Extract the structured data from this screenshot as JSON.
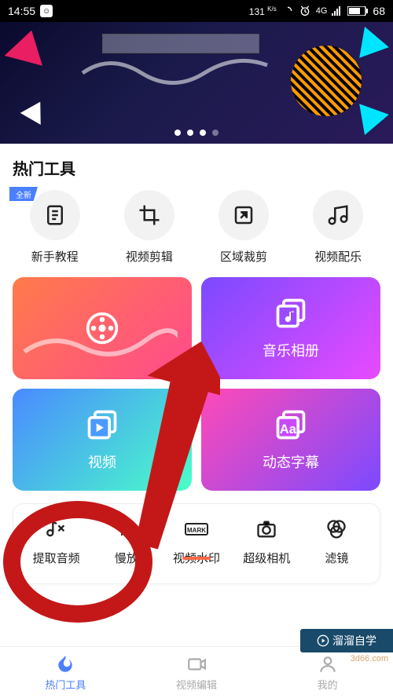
{
  "status": {
    "time": "14:55",
    "net_speed": "131",
    "net_unit": "K/s",
    "signal": "4G",
    "battery": "68"
  },
  "banner": {
    "dots": 4,
    "active_dot": 3
  },
  "section_title": "热门工具",
  "tools": [
    {
      "label": "新手教程",
      "icon": "doc-icon",
      "badge": "全新"
    },
    {
      "label": "视频剪辑",
      "icon": "crop-icon",
      "badge": null
    },
    {
      "label": "区域裁剪",
      "icon": "expand-icon",
      "badge": null
    },
    {
      "label": "视频配乐",
      "icon": "music-icon",
      "badge": null
    }
  ],
  "cards": [
    {
      "label": "",
      "icon": "film-icon",
      "cls": "c1"
    },
    {
      "label": "音乐相册",
      "icon": "music-stack-icon",
      "cls": "c2"
    },
    {
      "label": "视频",
      "icon": "play-stack-icon",
      "cls": "c3"
    },
    {
      "label": "动态字幕",
      "icon": "aa-stack-icon",
      "cls": "c4"
    }
  ],
  "row_tools": [
    {
      "label": "提取音频",
      "icon": "extract-audio-icon",
      "active": false
    },
    {
      "label": "慢放",
      "icon": "slowmo-icon",
      "active": false
    },
    {
      "label": "视频水印",
      "icon": "watermark-icon",
      "active": true
    },
    {
      "label": "超级相机",
      "icon": "camera-icon",
      "active": false
    },
    {
      "label": "滤镜",
      "icon": "filter-icon",
      "active": false
    }
  ],
  "nav": [
    {
      "label": "热门工具",
      "icon": "flame-icon",
      "active": true
    },
    {
      "label": "视频编辑",
      "icon": "video-icon",
      "active": false
    },
    {
      "label": "我的",
      "icon": "person-icon",
      "active": false
    }
  ],
  "watermark": {
    "text": "溜溜自学",
    "sub": "3d66.com"
  }
}
